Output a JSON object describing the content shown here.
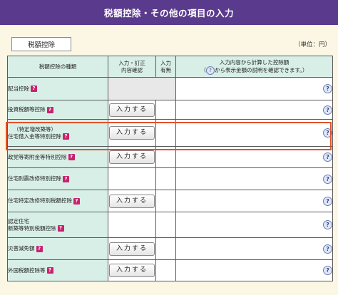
{
  "title": "税額控除・その他の項目の入力",
  "category_label": "税額控除",
  "unit_label": "（単位：円）",
  "header": {
    "type": "税額控除の種類",
    "input_confirm": "入力・訂正\n内容確認",
    "input_presence": "入力\n有無",
    "amount_line1": "入力内容から計算した控除額",
    "amount_line2_pre": "（",
    "amount_line2_post": "から表示金額の説明を確認できます。）",
    "info_glyph": "?"
  },
  "enter_button_label": "入力する",
  "help_glyph": "?",
  "rows": [
    {
      "name": "配当控除",
      "has_button": false
    },
    {
      "name": "投資税額等控除",
      "has_button": true
    },
    {
      "name_line1": "（特定増改築等）",
      "name_line2": "住宅借入金等特別控除",
      "has_button": true
    },
    {
      "name": "政党等寄附金等特別控除",
      "has_button": true
    },
    {
      "name": "住宅耐震改修特別控除",
      "has_button": false
    },
    {
      "name": "住宅特定改修特別税額控除",
      "has_button": true
    },
    {
      "name_line1": "認定住宅",
      "name_line2": "新築等特別税額控除",
      "has_button": false
    },
    {
      "name": "災害減免額",
      "has_button": true
    },
    {
      "name": "外国税額控除等",
      "has_button": true
    }
  ]
}
